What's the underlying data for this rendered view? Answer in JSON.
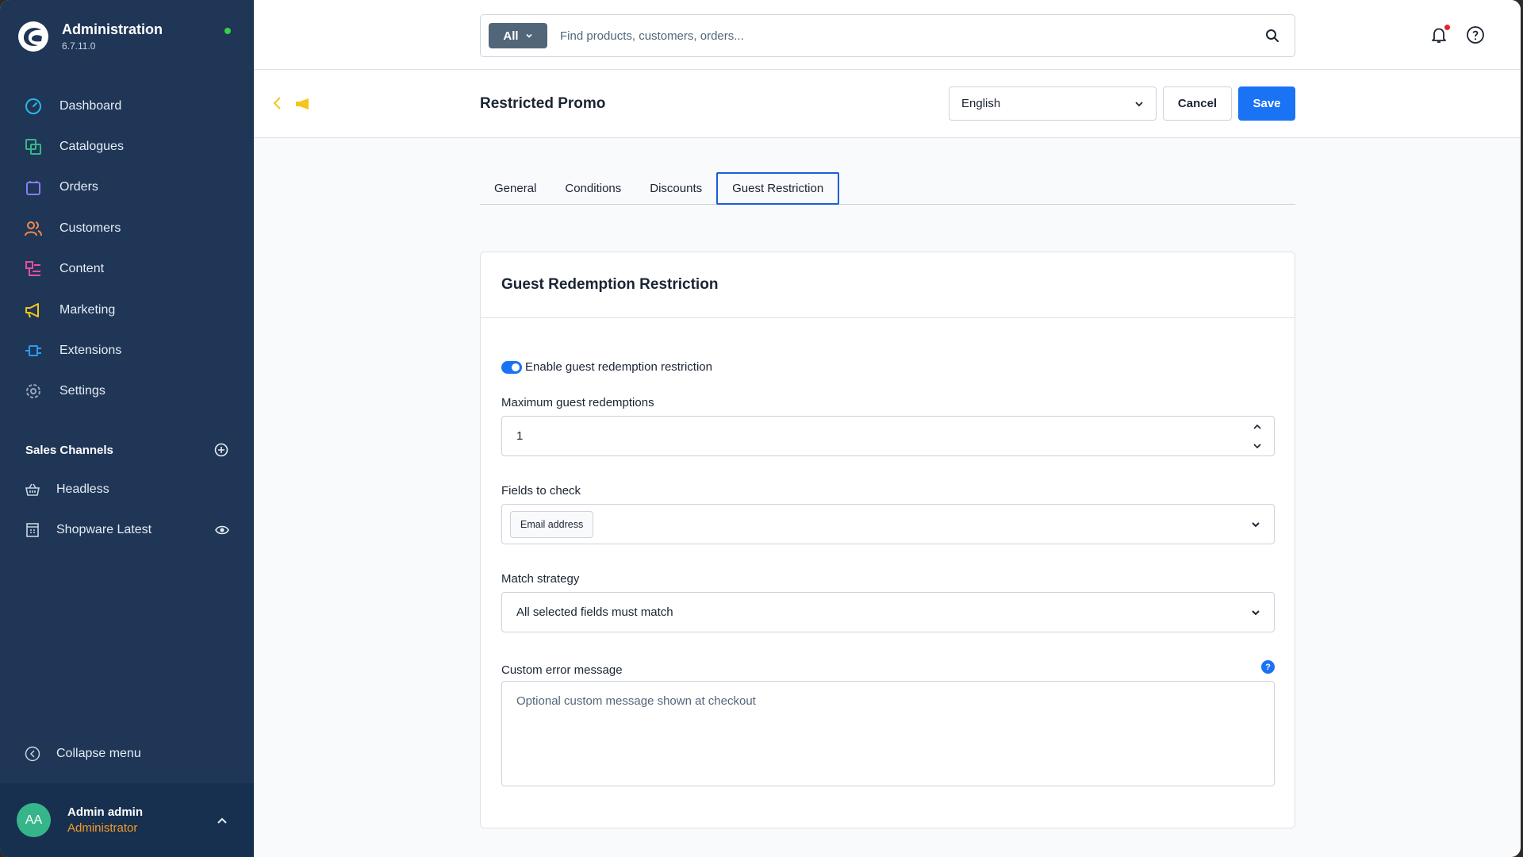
{
  "app": {
    "title": "Administration",
    "version": "6.7.11.0",
    "status_color": "#37d046"
  },
  "sidebar": {
    "items": [
      {
        "label": "Dashboard",
        "icon": "dashboard-icon",
        "color": "#2bb7e8"
      },
      {
        "label": "Catalogues",
        "icon": "catalogues-icon",
        "color": "#37b58a"
      },
      {
        "label": "Orders",
        "icon": "orders-icon",
        "color": "#8b7cf6"
      },
      {
        "label": "Customers",
        "icon": "customers-icon",
        "color": "#f28a4b"
      },
      {
        "label": "Content",
        "icon": "content-icon",
        "color": "#e84ea0"
      },
      {
        "label": "Marketing",
        "icon": "marketing-icon",
        "color": "#f5c518"
      },
      {
        "label": "Extensions",
        "icon": "extensions-icon",
        "color": "#2b9bf0"
      },
      {
        "label": "Settings",
        "icon": "settings-icon",
        "color": "#9aa7b8"
      }
    ],
    "sales_channels_title": "Sales Channels",
    "channels": [
      {
        "label": "Headless",
        "icon": "basket-icon"
      },
      {
        "label": "Shopware Latest",
        "icon": "storefront-icon"
      }
    ],
    "collapse_label": "Collapse menu",
    "user": {
      "initials": "AA",
      "name": "Admin admin",
      "role": "Administrator"
    }
  },
  "search": {
    "scope": "All",
    "placeholder": "Find products, customers, orders..."
  },
  "smartbar": {
    "title": "Restricted Promo",
    "language": "English",
    "cancel_label": "Cancel",
    "save_label": "Save"
  },
  "tabs": [
    {
      "label": "General",
      "active": false
    },
    {
      "label": "Conditions",
      "active": false
    },
    {
      "label": "Discounts",
      "active": false
    },
    {
      "label": "Guest Restriction",
      "active": true
    }
  ],
  "card": {
    "title": "Guest Redemption Restriction",
    "toggle_label": "Enable guest redemption restriction",
    "toggle_on": true,
    "max_label": "Maximum guest redemptions",
    "max_value": "1",
    "fields_label": "Fields to check",
    "fields_selected": [
      "Email address"
    ],
    "match_label": "Match strategy",
    "match_value": "All selected fields must match",
    "error_label": "Custom error message",
    "error_placeholder": "Optional custom message shown at checkout",
    "help_glyph": "?"
  },
  "colors": {
    "sidebar_bg": "#1f3656",
    "primary": "#1a72f5",
    "role_color": "#f59a2b",
    "avatar_bg": "#37b58a"
  }
}
